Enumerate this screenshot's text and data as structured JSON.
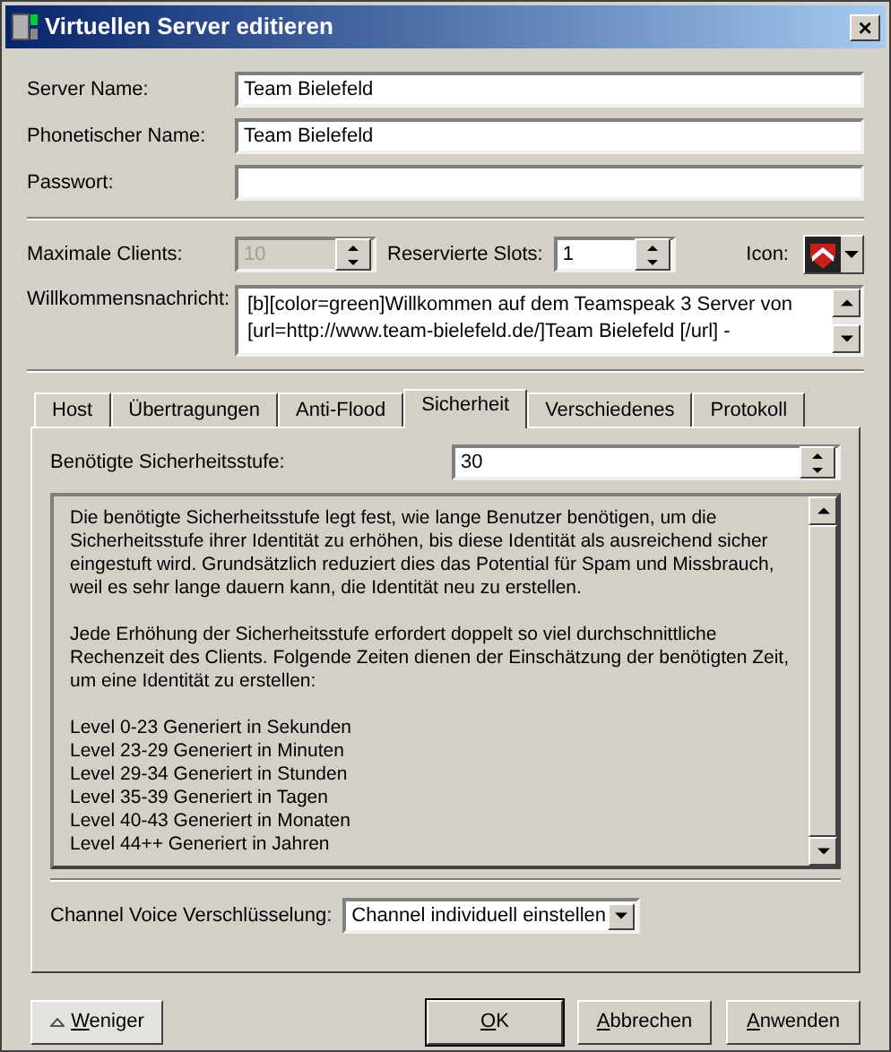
{
  "window": {
    "title": "Virtuellen Server editieren",
    "close": "×"
  },
  "fields": [
    {
      "label": "Server Name:",
      "value": "Team Bielefeld"
    },
    {
      "label": "Phonetischer Name:",
      "value": "Team Bielefeld"
    },
    {
      "label": "Passwort:"
    }
  ],
  "max_clients": {
    "label": "Maximale Clients:",
    "value": "10",
    "disabled": true
  },
  "reserved_slots": {
    "label": "Reservierte Slots:",
    "value": "1",
    "disabled": false
  },
  "icon": {
    "label": "Icon:"
  },
  "welcome": {
    "label": "Willkommensnachricht:",
    "lines": [
      "[b][color=green]Willkommen auf dem Teamspeak 3 Server von",
      "[url=http://www.team-bielefeld.de/]Team Bielefeld [/url] -"
    ]
  },
  "tabs": [
    {
      "label": "Host",
      "selected": false
    },
    {
      "label": "Übertragungen",
      "selected": false
    },
    {
      "label": "Anti-Flood",
      "selected": false
    },
    {
      "label": "Sicherheit",
      "selected": true
    },
    {
      "label": "Verschiedenes",
      "selected": false
    },
    {
      "label": "Protokoll",
      "selected": false
    }
  ],
  "security_level": {
    "label": "Benötigte Sicherheitsstufe:",
    "value": "30"
  },
  "info_paragraphs": [
    "Die benötigte Sicherheitsstufe legt fest, wie lange Benutzer benötigen, um die Sicherheitsstufe ihrer Identität zu erhöhen, bis diese Identität als ausreichend sicher eingestuft wird. Grundsätzlich reduziert dies das Potential für Spam und Missbrauch, weil es sehr lange dauern kann, die Identität neu zu erstellen.",
    "Jede Erhöhung der Sicherheitsstufe erfordert doppelt so viel durchschnittliche Rechenzeit des Clients. Folgende Zeiten dienen der Einschätzung der benötigten Zeit, um eine Identität zu erstellen:"
  ],
  "info_levels": [
    "Level 0-23 Generiert in Sekunden",
    "Level 23-29 Generiert in Minuten",
    "Level 29-34 Generiert in Stunden",
    "Level 35-39 Generiert in Tagen",
    "Level 40-43 Generiert in Monaten",
    "Level 44++ Generiert in Jahren"
  ],
  "voice_encryption": {
    "label": "Channel Voice Verschlüsselung:",
    "value": "Channel individuell einstellen"
  },
  "less_button": {
    "label": "Weniger",
    "mnemonic": true
  },
  "buttons": [
    {
      "label": "OK",
      "mnemonic": true,
      "default": true
    },
    {
      "label": "Abbrechen",
      "mnemonic": true,
      "default": false
    },
    {
      "label": "Anwenden",
      "mnemonic": true,
      "default": false
    }
  ]
}
